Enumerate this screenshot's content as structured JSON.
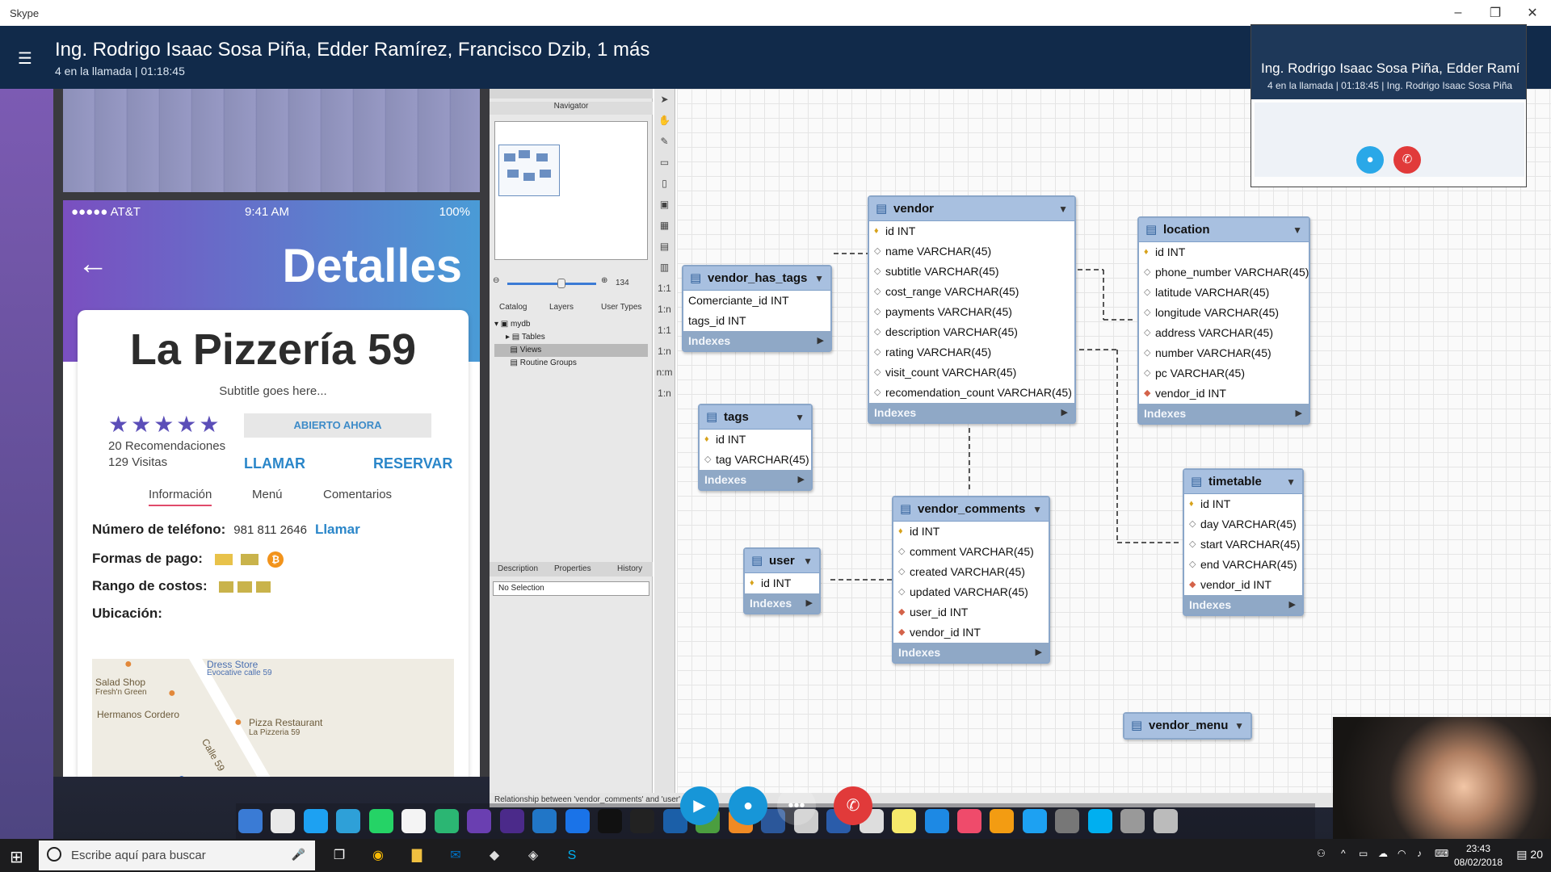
{
  "skype": {
    "app_title": "Skype",
    "call_title": "Ing. Rodrigo Isaac Sosa Piña, Edder Ramírez, Francisco Dzib, 1 más",
    "call_status": "4 en la llamada | 01:18:45",
    "preview_title": "Ing. Rodrigo Isaac Sosa Piña, Edder Ramírez",
    "preview_status": "4 en la llamada | 01:18:45 | Ing. Rodrigo Isaac Sosa Piña",
    "accent": "#2aa8e8",
    "hangup_color": "#e13a3a"
  },
  "phone": {
    "carrier": "●●●●● AT&T",
    "time": "9:41 AM",
    "battery": "100%",
    "header": "Detalles",
    "restaurant": "La Pizzería 59",
    "subtitle": "Subtitle goes here...",
    "rating_stars": 5,
    "recommendations": "20 Recomendaciones",
    "visits": "129 Visitas",
    "open_badge": "ABIERTO AHORA",
    "call_label": "LLAMAR",
    "reserve_label": "RESERVAR",
    "tabs": [
      "Información",
      "Menú",
      "Comentarios"
    ],
    "phone_label": "Número de teléfono:",
    "phone_value": "981 811 2646",
    "phone_link": "Llamar",
    "payment_label": "Formas de pago:",
    "cost_label": "Rango de costos:",
    "location_label": "Ubicación:",
    "map_labels": [
      "Dress Store",
      "Evocative calle 59",
      "Salad Shop",
      "Fresh'n Green",
      "Hermanos Cordero",
      "Pizza Restaurant",
      "La Pizzeria 59",
      "Calle 59"
    ]
  },
  "workbench": {
    "navigator_title": "Navigator",
    "zoom_value": "134",
    "catalog_tabs": [
      "Catalog",
      "Layers",
      "User Types"
    ],
    "tree": [
      "mydb",
      "Tables",
      "Views",
      "Routine Groups"
    ],
    "desc_tabs": [
      "Description",
      "Properties",
      "History"
    ],
    "no_selection": "No Selection",
    "status": "Relationship between 'vendor_comments' and 'user' created",
    "tables": {
      "vendor_has_tags": {
        "name": "vendor_has_tags",
        "cols": [
          "Comerciante_id INT",
          "tags_id INT"
        ]
      },
      "tags": {
        "name": "tags",
        "cols": [
          "id INT",
          "tag VARCHAR(45)"
        ]
      },
      "vendor": {
        "name": "vendor",
        "cols": [
          "id INT",
          "name VARCHAR(45)",
          "subtitle VARCHAR(45)",
          "cost_range VARCHAR(45)",
          "payments VARCHAR(45)",
          "description VARCHAR(45)",
          "rating VARCHAR(45)",
          "visit_count VARCHAR(45)",
          "recomendation_count VARCHAR(45)"
        ]
      },
      "location": {
        "name": "location",
        "cols": [
          "id INT",
          "phone_number VARCHAR(45)",
          "latitude VARCHAR(45)",
          "longitude VARCHAR(45)",
          "address VARCHAR(45)",
          "number VARCHAR(45)",
          "pc VARCHAR(45)",
          "vendor_id INT"
        ]
      },
      "user": {
        "name": "user",
        "cols": [
          "id INT"
        ]
      },
      "vendor_comments": {
        "name": "vendor_comments",
        "cols": [
          "id INT",
          "comment VARCHAR(45)",
          "created VARCHAR(45)",
          "updated VARCHAR(45)",
          "user_id INT",
          "vendor_id INT"
        ]
      },
      "timetable": {
        "name": "timetable",
        "cols": [
          "id INT",
          "day VARCHAR(45)",
          "start VARCHAR(45)",
          "end VARCHAR(45)",
          "vendor_id INT"
        ]
      },
      "vendor_menu": {
        "name": "vendor_menu"
      }
    },
    "indexes_label": "Indexes"
  },
  "taskbar": {
    "search_placeholder": "Escribe aquí para buscar",
    "time": "23:43",
    "date": "08/02/2018",
    "notifications": "20"
  }
}
